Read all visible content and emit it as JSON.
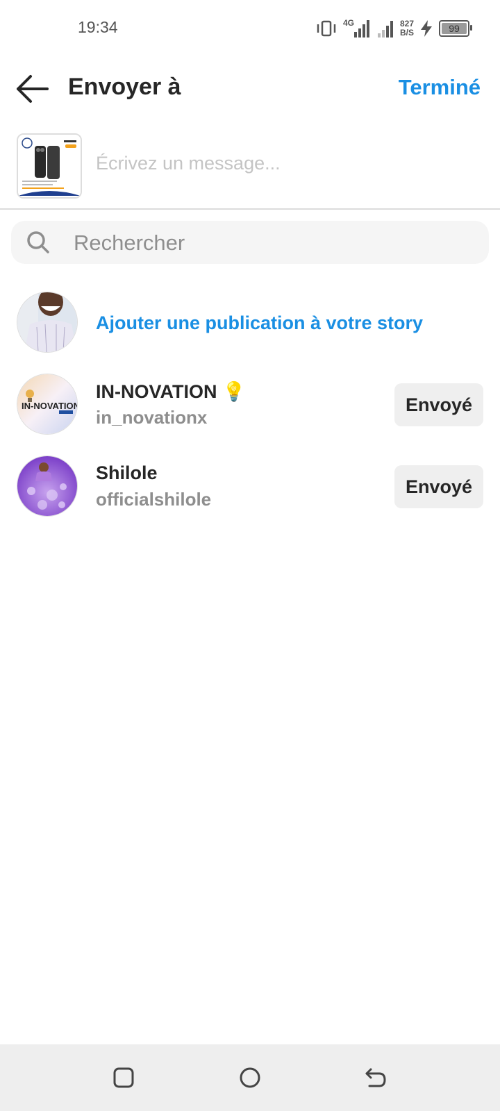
{
  "status_bar": {
    "time": "19:34",
    "network_type": "4G",
    "net_speed_value": "827",
    "net_speed_unit": "B/S",
    "battery_level": "99"
  },
  "header": {
    "title": "Envoyer à",
    "done_label": "Terminé"
  },
  "message": {
    "placeholder": "Écrivez un message..."
  },
  "search": {
    "placeholder": "Rechercher"
  },
  "story": {
    "label": "Ajouter une publication à votre story"
  },
  "contacts": [
    {
      "name": "IN-NOVATION 💡",
      "handle": "in_novationx",
      "button_label": "Envoyé"
    },
    {
      "name": "Shilole",
      "handle": "officialshilole",
      "button_label": "Envoyé"
    }
  ],
  "colors": {
    "accent": "#1a8fe3",
    "text_primary": "#262626",
    "text_secondary": "#8e8e8e",
    "button_bg": "#efefef"
  },
  "icons": {
    "back": "arrow-left-icon",
    "search": "search-icon",
    "nav_recent": "square-icon",
    "nav_home": "circle-icon",
    "nav_back": "return-arrow-icon"
  }
}
